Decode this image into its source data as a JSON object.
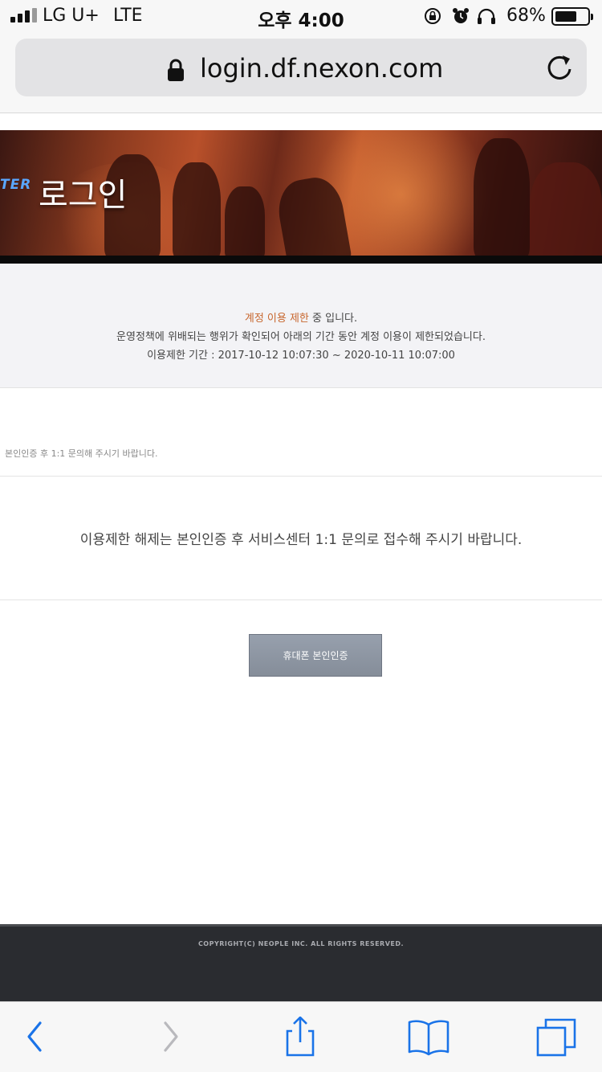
{
  "status_bar": {
    "carrier": "LG U+",
    "network": "LTE",
    "time": "오후 4:00",
    "battery_percent": "68%",
    "battery_level": 0.68
  },
  "address_bar": {
    "url": "login.df.nexon.com"
  },
  "banner": {
    "logo_text": "TER",
    "title": "로그인"
  },
  "notice": {
    "line1_highlight": "계정 이용 제한",
    "line1_rest": " 중 입니다.",
    "line2": "운영정책에 위배되는 행위가 확인되어 아래의 기간 동안 계정 이용이 제한되었습니다.",
    "line3": "이용제한 기간 : 2017-10-12 10:07:30 ~ 2020-10-11 10:07:00"
  },
  "guide": {
    "small": "본인인증 후 1:1 문의해 주시기 바랍니다.",
    "large": "이용제한 해제는 본인인증 후 서비스센터 1:1 문의로 접수해 주시기 바랍니다."
  },
  "buttons": {
    "verify_label": "휴대폰 본인인증"
  },
  "footer": {
    "copyright": "COPYRIGHT(C) NEOPLE INC. ALL RIGHTS RESERVED."
  },
  "toolbar": {
    "icons": [
      "back-icon",
      "forward-icon",
      "share-icon",
      "bookmarks-icon",
      "tabs-icon"
    ],
    "accent_color": "#1a73e8",
    "disabled_color": "#b9b9bd"
  }
}
